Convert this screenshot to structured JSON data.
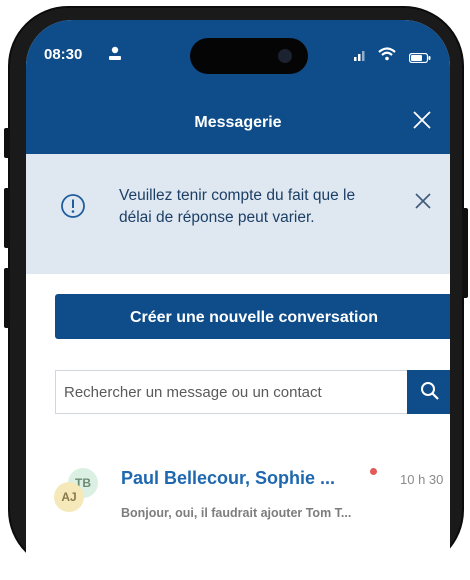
{
  "status_bar": {
    "time": "08:30",
    "icons": [
      "person-icon",
      "signal-icon",
      "wifi-icon",
      "battery-icon"
    ]
  },
  "header": {
    "title": "Messagerie",
    "close_icon": "close-icon"
  },
  "banner": {
    "icon": "info-icon",
    "text": "Veuillez tenir compte du fait que le délai de réponse peut varier.",
    "close_icon": "close-icon"
  },
  "actions": {
    "create_label": "Créer une nouvelle conversation"
  },
  "search": {
    "placeholder": "Rechercher un message ou un contact",
    "value": "",
    "icon": "search-icon"
  },
  "conversations": [
    {
      "avatars": [
        "TB",
        "AJ"
      ],
      "name": "Paul Bellecour, Sophie ...",
      "unread": true,
      "time": "10 h 30",
      "preview": "Bonjour, oui, il faudrait ajouter Tom T..."
    }
  ],
  "colors": {
    "primary": "#0f4d8a",
    "banner_bg": "#dfe8f1",
    "link": "#1f68b0",
    "unread_dot": "#e25a5a"
  }
}
